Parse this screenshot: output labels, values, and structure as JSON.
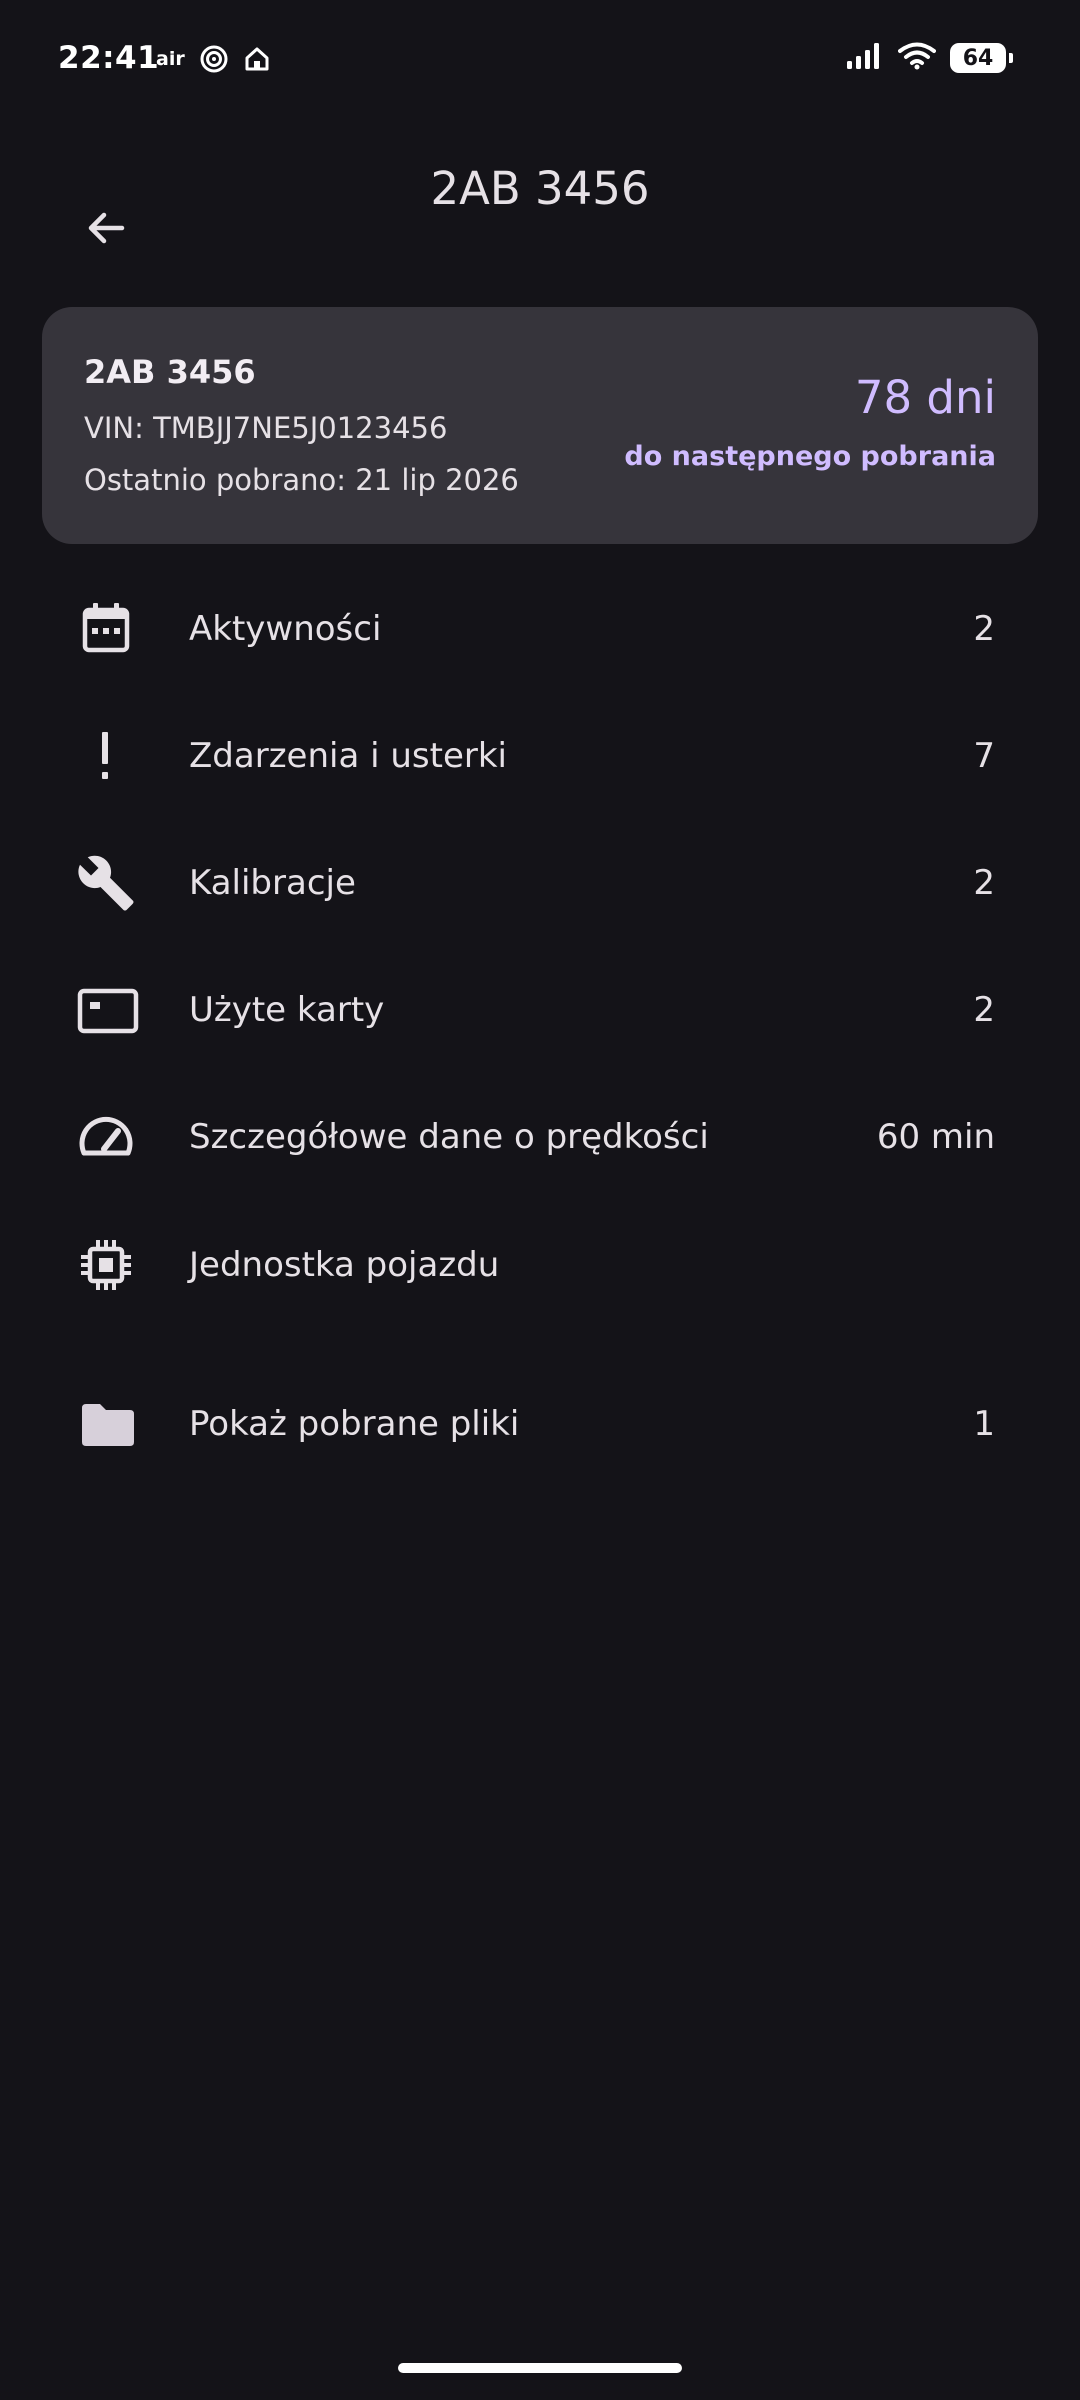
{
  "status_bar": {
    "time": "22:41",
    "air_label": "air",
    "battery": "64"
  },
  "header": {
    "title": "2AB 3456"
  },
  "summary": {
    "plate": "2AB 3456",
    "vin": "VIN: TMBJJ7NE5J0123456",
    "last_download": "Ostatnio pobrano: 21 lip 2026",
    "days": "78 dni",
    "days_caption": "do następnego pobrania"
  },
  "menu": {
    "items": [
      {
        "icon": "calendar-icon",
        "label": "Aktywności",
        "value": "2"
      },
      {
        "icon": "exclamation-icon",
        "label": "Zdarzenia i usterki",
        "value": "7"
      },
      {
        "icon": "wrench-icon",
        "label": "Kalibracje",
        "value": "2"
      },
      {
        "icon": "card-icon",
        "label": "Użyte karty",
        "value": "2"
      },
      {
        "icon": "speedometer-icon",
        "label": "Szczegółowe dane o prędkości",
        "value": "60 min"
      },
      {
        "icon": "chip-icon",
        "label": "Jednostka pojazdu",
        "value": ""
      },
      {
        "icon": "folder-icon",
        "label": "Pokaż pobrane pliki",
        "value": "1"
      }
    ]
  },
  "colors": {
    "background": "#141318",
    "card": "#36343b",
    "accent": "#d0bcff",
    "text": "#e6e1e6"
  }
}
